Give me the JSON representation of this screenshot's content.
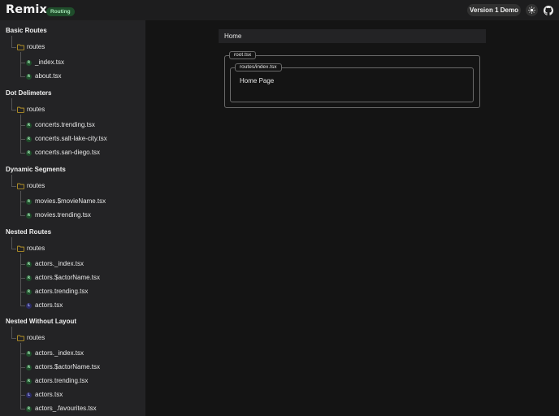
{
  "header": {
    "logo": "Remix",
    "badge": "Routing",
    "version_button": "Version 1 Demo",
    "theme_icon": "sun-icon",
    "github_icon": "github-icon"
  },
  "sidebar": {
    "sections": [
      {
        "title": "Basic Routes",
        "folder": "routes",
        "files": [
          {
            "badge": "R",
            "name": "_index.tsx"
          },
          {
            "badge": "R",
            "name": "about.tsx"
          }
        ]
      },
      {
        "title": "Dot Delimeters",
        "folder": "routes",
        "files": [
          {
            "badge": "R",
            "name": "concerts.trending.tsx"
          },
          {
            "badge": "R",
            "name": "concerts.salt-lake-city.tsx"
          },
          {
            "badge": "R",
            "name": "concerts.san-diego.tsx"
          }
        ]
      },
      {
        "title": "Dynamic Segments",
        "folder": "routes",
        "files": [
          {
            "badge": "R",
            "name": "movies.$movieName.tsx"
          },
          {
            "badge": "R",
            "name": "movies.trending.tsx"
          }
        ]
      },
      {
        "title": "Nested Routes",
        "folder": "routes",
        "files": [
          {
            "badge": "R",
            "name": "actors._index.tsx"
          },
          {
            "badge": "R",
            "name": "actors.$actorName.tsx"
          },
          {
            "badge": "R",
            "name": "actors.trending.tsx"
          },
          {
            "badge": "L",
            "name": "actors.tsx"
          }
        ]
      },
      {
        "title": "Nested Without Layout",
        "folder": "routes",
        "files": [
          {
            "badge": "R",
            "name": "actors._index.tsx"
          },
          {
            "badge": "R",
            "name": "actors.$actorName.tsx"
          },
          {
            "badge": "R",
            "name": "actors.trending.tsx"
          },
          {
            "badge": "L",
            "name": "actors.tsx"
          },
          {
            "badge": "R",
            "name": "actors_.favourites.tsx"
          }
        ]
      }
    ]
  },
  "main": {
    "address": "Home",
    "root_tag": "root.tsx",
    "index_tag": "routes/index.tsx",
    "page_text": "Home Page"
  },
  "colors": {
    "route_badge_bg": "#1f4d2b",
    "layout_badge_bg": "#2b2b66",
    "folder": "#c9a227"
  }
}
